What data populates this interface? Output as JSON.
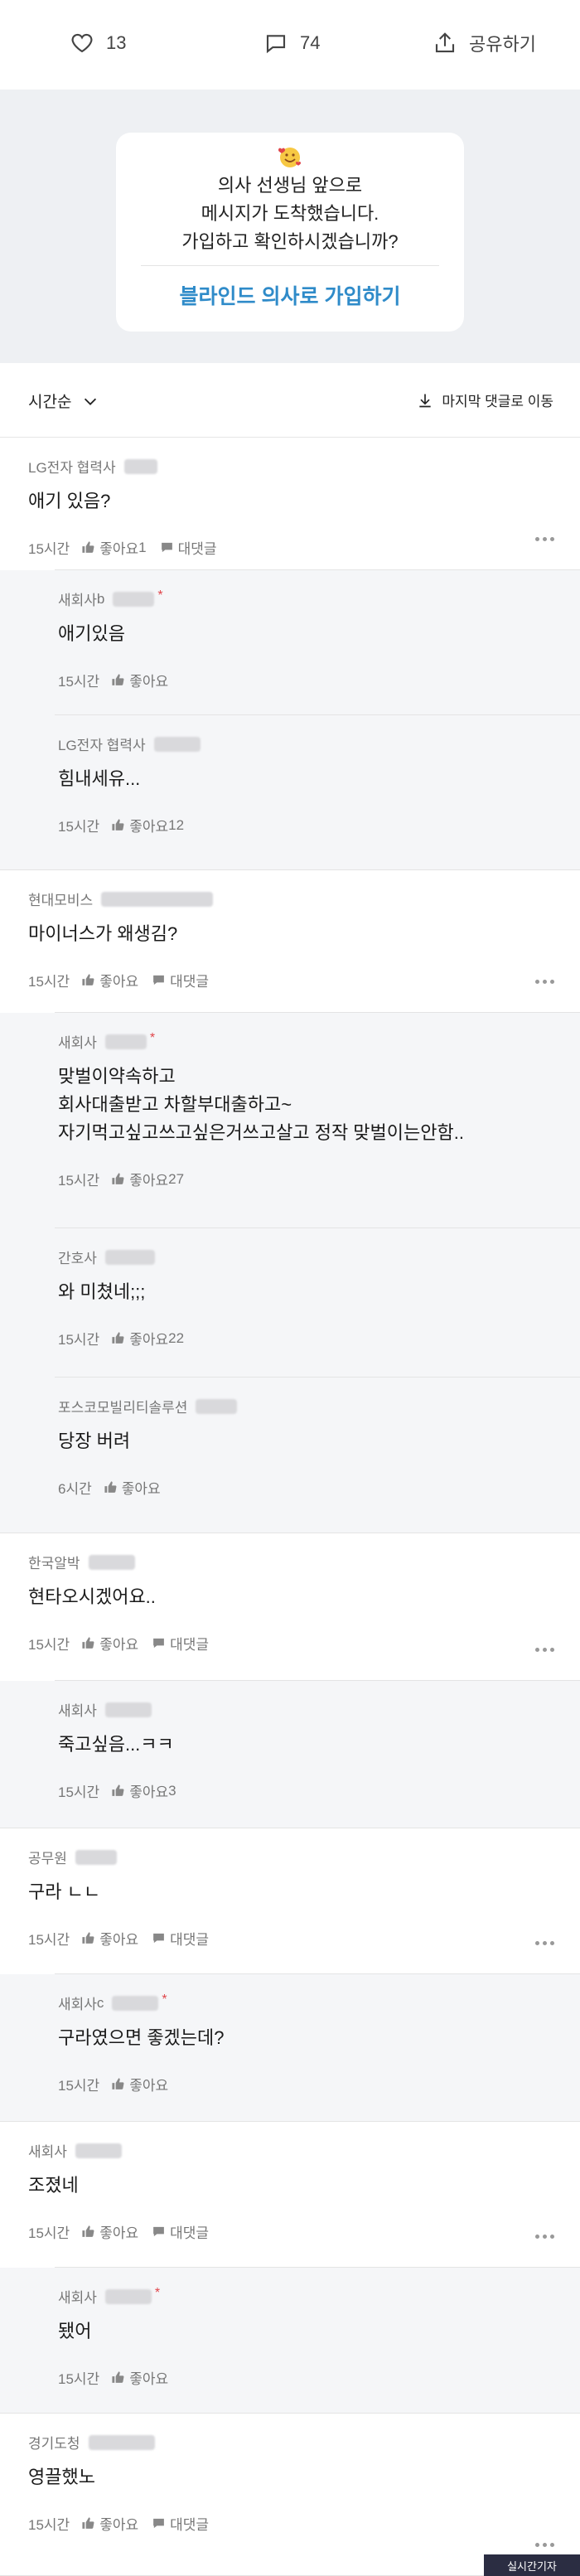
{
  "actions": {
    "likes": "13",
    "comments": "74",
    "share": "공유하기"
  },
  "promo": {
    "line1": "의사 선생님 앞으로",
    "line2": "메시지가 도착했습니다.",
    "line3": "가입하고 확인하시겠습니까?",
    "cta": "블라인드 의사로 가입하기",
    "emoji": "smiling-face-hearts-emoji"
  },
  "sort": {
    "label": "시간순",
    "jump": "마지막 댓글로 이동"
  },
  "labels": {
    "like": "좋아요",
    "reply": "대댓글"
  },
  "comments": [
    {
      "company": "LG전자 협력사",
      "text": [
        "애기 있음?"
      ],
      "time": "15시간",
      "likes": "1",
      "reply": true
    },
    {
      "company": "새회사",
      "nick": "b",
      "op": true,
      "text": [
        "애기있음"
      ],
      "time": "15시간",
      "likes": ""
    },
    {
      "company": "LG전자 협력사",
      "text": [
        "힘내세유..."
      ],
      "time": "15시간",
      "likes": "12"
    },
    {
      "company": "현대모비스",
      "text": [
        "마이너스가 왜생김?"
      ],
      "time": "15시간",
      "likes": "",
      "reply": true
    },
    {
      "company": "새회사",
      "op": true,
      "text": [
        "맞벌이약속하고",
        "회사대출받고 차할부대출하고~",
        "자기먹고싶고쓰고싶은거쓰고살고 정작 맞벌이는안함.."
      ],
      "time": "15시간",
      "likes": "27"
    },
    {
      "company": "간호사",
      "text": [
        "와 미쳤네;;;"
      ],
      "time": "15시간",
      "likes": "22"
    },
    {
      "company": "포스코모빌리티솔루션",
      "text": [
        "당장 버려"
      ],
      "time": "6시간",
      "likes": ""
    },
    {
      "company": "한국알박",
      "text": [
        "현타오시겠어요.."
      ],
      "time": "15시간",
      "likes": "",
      "reply": true
    },
    {
      "company": "새회사",
      "text": [
        "죽고싶음...ㅋㅋ"
      ],
      "time": "15시간",
      "likes": "3"
    },
    {
      "company": "공무원",
      "text": [
        "구라 ㄴㄴ"
      ],
      "time": "15시간",
      "likes": "",
      "reply": true
    },
    {
      "company": "새회사",
      "nick": "c",
      "op": true,
      "text": [
        "구라였으면 좋겠는데?"
      ],
      "time": "15시간",
      "likes": ""
    },
    {
      "company": "새회사",
      "text": [
        "조졌네"
      ],
      "time": "15시간",
      "likes": "",
      "reply": true
    },
    {
      "company": "새회사",
      "op": true,
      "text": [
        "됐어"
      ],
      "time": "15시간",
      "likes": ""
    },
    {
      "company": "경기도청",
      "text": [
        "영끌했노"
      ],
      "time": "15시간",
      "likes": "",
      "reply": true
    }
  ],
  "watermark": "실시간기자"
}
